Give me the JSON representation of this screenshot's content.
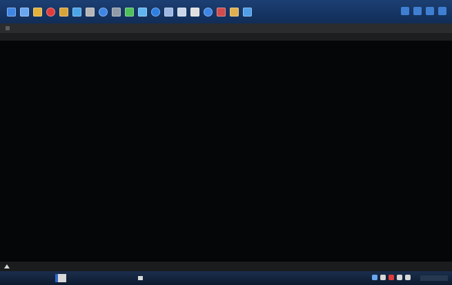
{
  "topbar": {
    "icons": [
      {
        "name": "app-icon-1",
        "color": "#3f86e4"
      },
      {
        "name": "app-icon-2",
        "color": "#6aa6f0"
      },
      {
        "name": "app-icon-3",
        "color": "#e3b23c"
      },
      {
        "name": "app-icon-4",
        "color": "#e03c3c"
      },
      {
        "name": "app-icon-5",
        "color": "#d7a43a"
      },
      {
        "name": "app-icon-6",
        "color": "#4aa6e8"
      },
      {
        "name": "app-icon-7",
        "color": "#b6b6b6"
      },
      {
        "name": "app-icon-8",
        "color": "#3f86e4"
      },
      {
        "name": "app-icon-9",
        "color": "#8f9ba8"
      },
      {
        "name": "app-icon-10",
        "color": "#4ec15a"
      },
      {
        "name": "app-icon-11",
        "color": "#5fb5ef"
      },
      {
        "name": "app-icon-12",
        "color": "#2f7fe0"
      },
      {
        "name": "app-icon-13",
        "color": "#9db7e3"
      },
      {
        "name": "app-icon-14",
        "color": "#c9d6e8"
      },
      {
        "name": "app-icon-15",
        "color": "#e0e0e0"
      },
      {
        "name": "app-icon-16",
        "color": "#3f86e4"
      },
      {
        "name": "app-icon-17",
        "color": "#d14c4c"
      },
      {
        "name": "app-icon-18",
        "color": "#e0b050"
      },
      {
        "name": "app-icon-19",
        "color": "#4f9ee8"
      }
    ]
  },
  "window": {
    "title": "",
    "menu": []
  },
  "terminal": {
    "header": "",
    "rows": [],
    "footer": ""
  },
  "status": {
    "text": ""
  },
  "taskbar": {
    "task_label": ""
  },
  "colors": {
    "terminal_text": "#5fbf5a",
    "terminal_bg": "#050607",
    "topbar_bg": "#1c3f73",
    "taskbar_bg": "#1a2e4c"
  }
}
